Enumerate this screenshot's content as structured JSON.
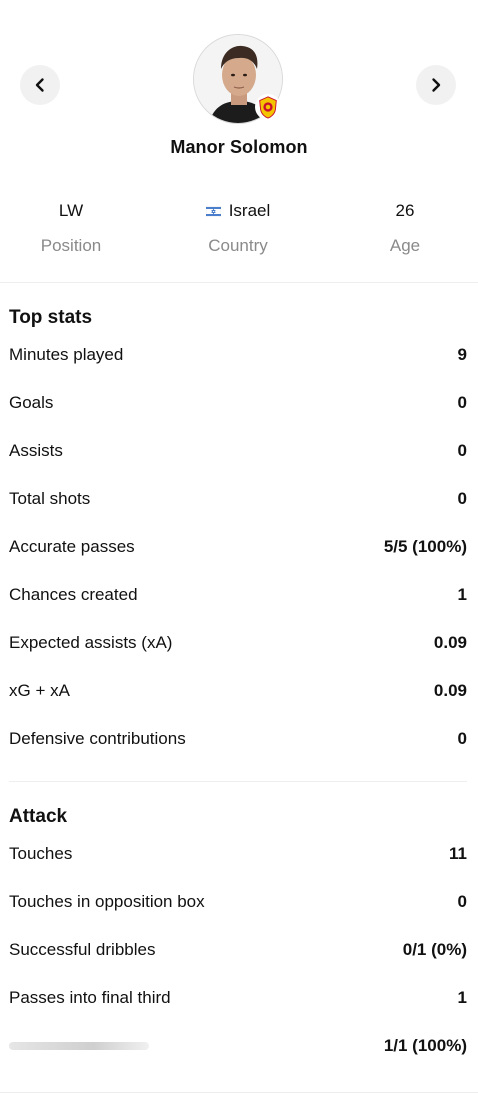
{
  "header": {
    "player_name": "Manor Solomon",
    "prev_icon": "chevron-left-icon",
    "next_icon": "chevron-right-icon",
    "badge_icon": "club-crest-icon"
  },
  "info": {
    "position": {
      "value": "LW",
      "label": "Position"
    },
    "country": {
      "value": "Israel",
      "label": "Country",
      "flag_icon": "israel-flag-icon"
    },
    "age": {
      "value": "26",
      "label": "Age"
    }
  },
  "top_stats": {
    "title": "Top stats",
    "rows": [
      {
        "label": "Minutes played",
        "value": "9"
      },
      {
        "label": "Goals",
        "value": "0"
      },
      {
        "label": "Assists",
        "value": "0"
      },
      {
        "label": "Total shots",
        "value": "0"
      },
      {
        "label": "Accurate passes",
        "value": "5/5 (100%)"
      },
      {
        "label": "Chances created",
        "value": "1"
      },
      {
        "label": "Expected assists (xA)",
        "value": "0.09"
      },
      {
        "label": "xG + xA",
        "value": "0.09"
      },
      {
        "label": "Defensive contributions",
        "value": "0"
      }
    ]
  },
  "attack": {
    "title": "Attack",
    "rows": [
      {
        "label": "Touches",
        "value": "11"
      },
      {
        "label": "Touches in opposition box",
        "value": "0"
      },
      {
        "label": "Successful dribbles",
        "value": "0/1 (0%)"
      },
      {
        "label": "Passes into final third",
        "value": "1"
      },
      {
        "label": "",
        "value": "1/1 (100%)"
      }
    ]
  },
  "colors": {
    "muted_text": "#8a8a8a",
    "nav_button_bg": "#f1f1f1",
    "divider": "#eeeeee",
    "club_yellow": "#f5c400",
    "club_red": "#c8102e"
  }
}
